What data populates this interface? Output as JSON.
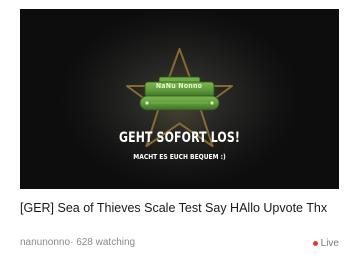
{
  "thumbnail": {
    "banner_name": "NaNu Nonno",
    "headline": "GEHT SOFORT LOS!",
    "subline": "MACHT ES EUCH BEQUEM :)",
    "colors": {
      "background": "#121212",
      "star_outline": "#8a6f35",
      "banner_green": "#5d9a3c",
      "banner_green_dark": "#3f6e28"
    }
  },
  "stream": {
    "title": "[GER] Sea of Thieves Scale Test Say HAllo Upvote Thx",
    "channel": "nanunonno",
    "separator": "·",
    "viewers": "628 watching",
    "live_label": "Live",
    "live_color": "#e53935"
  }
}
